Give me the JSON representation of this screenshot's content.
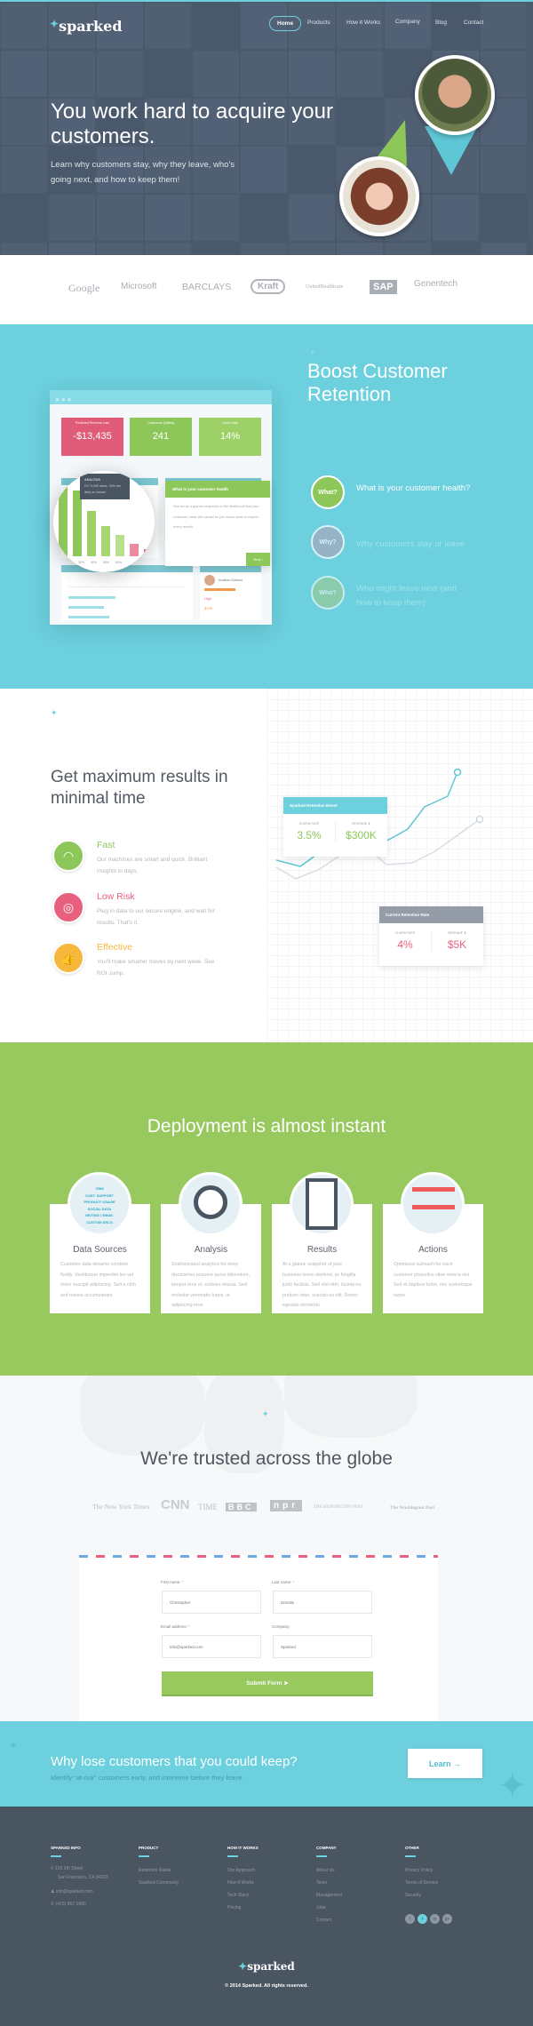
{
  "colors": {
    "accent": "#6dd0dd",
    "green": "#97c95f",
    "pink": "#e8607d",
    "yellow": "#f5b83d",
    "footer": "#4a5562"
  },
  "brand": "sparked",
  "nav": {
    "items": [
      "Home",
      "Products",
      "How it Works",
      "Company",
      "Blog",
      "Contact"
    ],
    "active": "Home"
  },
  "hero": {
    "title": "You work hard to acquire your customers.",
    "subtitle": "Learn why customers stay, why they leave, who's going next, and how to keep them!"
  },
  "client_logos": [
    "Google",
    "Microsoft",
    "BARCLAYS",
    "Kraft",
    "UnitedHealthcare",
    "SAP",
    "Genentech"
  ],
  "retention": {
    "title": "Boost Customer Retention",
    "questions": [
      {
        "badge": "What?",
        "text": "What is your customer health?",
        "active": true
      },
      {
        "badge": "Why?",
        "text": "Why customers stay or leave",
        "active": false
      },
      {
        "badge": "Who?",
        "text": "Who might leave next (and how to keep them)",
        "active": false
      }
    ],
    "mockup": {
      "kpis": [
        {
          "label": "Predicted Revenue Loss",
          "value": "-$13,435"
        },
        {
          "label": "Customers Quitting",
          "value": "241"
        },
        {
          "label": "Churn Rate",
          "value": "14%"
        }
      ],
      "tooltip": {
        "title": "ANALYSIS",
        "text": "Of 74,349 users, 30% are likely to cancel."
      },
      "bar_labels": [
        "30%",
        "40%",
        "50%",
        "60%"
      ],
      "popover": {
        "title": "What is your customer health",
        "body": "See an at-a-glance snapshot of the likelihood that your customer base will cancel so you know what to expect every month.",
        "next": "Next"
      },
      "profile": {
        "name": "Jonathan Garland",
        "risk": "High",
        "value": "$195"
      }
    }
  },
  "features": {
    "title": "Get maximum results in minimal time",
    "items": [
      {
        "title": "Fast",
        "text": "Our machines are smart and quick. Brilliant insights in days.",
        "icon": "speedometer-icon",
        "color": "#8dc75a"
      },
      {
        "title": "Low Risk",
        "text": "Plug in data to our secure engine, and wait for results. That's it.",
        "icon": "lifebuoy-icon",
        "color": "#e8607d"
      },
      {
        "title": "Effective",
        "text": "You'll make smarter moves by next week. See ROI Jump.",
        "icon": "thumbs-up-icon",
        "color": "#f5b83d"
      }
    ],
    "boost_card": {
      "title": "Sparked Retention Boost",
      "churn_label": "CHURN RATE",
      "churn": "3.5%",
      "revenue_label": "REVENUE ⬆",
      "revenue": "$300K"
    },
    "current_card": {
      "title": "Current Retention Rate",
      "churn_label": "CHURN RATE",
      "churn": "4%",
      "revenue_label": "REVENUE ⬆",
      "revenue": "$5K"
    }
  },
  "deploy": {
    "title": "Deployment is almost instant",
    "cards": [
      {
        "title": "Data Sources",
        "text": "Customer data streams combine fluidly. Vestibulum imperdiet leo vel tortor suscipit adipiscing. Sed a nibh sed massa accumsanani.",
        "tags": [
          "CRM",
          "CUST. SUPPORT",
          "PRODUCT USAGE",
          "SOCIAL DATA",
          "MKTING / EMAIL",
          "CUSTOM SRCS"
        ]
      },
      {
        "title": "Analysis",
        "text": "Sophisticated analytics for deep discoveries posuere purus bibendum, tempor eros et, sodales massa. Sed molestie venenatis turpis, ut adipiscing eros."
      },
      {
        "title": "Results",
        "text": "At a glance snapshot of your business lorem eleifend, ac fringilla justo facilisis. Sed nisl nibh, lacinia eu pretium vitae, suscipit eu elit. Donec egestas elementu."
      },
      {
        "title": "Actions",
        "text": "Optimized outreach for each customer phasellus vitae viverra nisi. Sed et dapibus tortor, nec scelerisque turpis."
      }
    ]
  },
  "trusted": {
    "title": "We're trusted across the globe",
    "press": [
      "The New York Times",
      "CNN",
      "TIME",
      "BBC",
      "npr",
      "THE HUFFINGTON POST",
      "The Washington Post"
    ]
  },
  "form": {
    "fields": [
      {
        "label": "First name:",
        "required": true,
        "placeholder": "Christopher"
      },
      {
        "label": "Last name:",
        "required": true,
        "placeholder": "Denalis"
      },
      {
        "label": "Email address:",
        "required": true,
        "placeholder": "info@sparked.com"
      },
      {
        "label": "Company:",
        "required": false,
        "placeholder": "Sparked"
      }
    ],
    "submit": "Submit Form"
  },
  "cta": {
    "title": "Why lose customers that you could keep?",
    "subtitle": "Identify “at-risk” customers early, and intervene before they leave.",
    "button": "Learn →"
  },
  "footer": {
    "columns": [
      {
        "heading": "SPARKED INFO",
        "items": [
          "155 9th Street",
          "San Francisco, CA 94103",
          "info@sparked.com",
          "(415) 967-1660"
        ]
      },
      {
        "heading": "PRODUCT",
        "items": [
          "Retention Radar",
          "Sparked Community"
        ]
      },
      {
        "heading": "HOW IT WORKS",
        "items": [
          "Our Approach",
          "How It Works",
          "Tech Stack",
          "Pricing"
        ]
      },
      {
        "heading": "COMPANY",
        "items": [
          "About Us",
          "Team",
          "Management",
          "Jobs",
          "Contact"
        ]
      },
      {
        "heading": "OTHER",
        "items": [
          "Privacy Policy",
          "Terms of Service",
          "Security"
        ]
      }
    ],
    "social": [
      "f",
      "t",
      "in",
      "g+"
    ],
    "copyright": "© 2014 Sparked. All rights reserved."
  }
}
